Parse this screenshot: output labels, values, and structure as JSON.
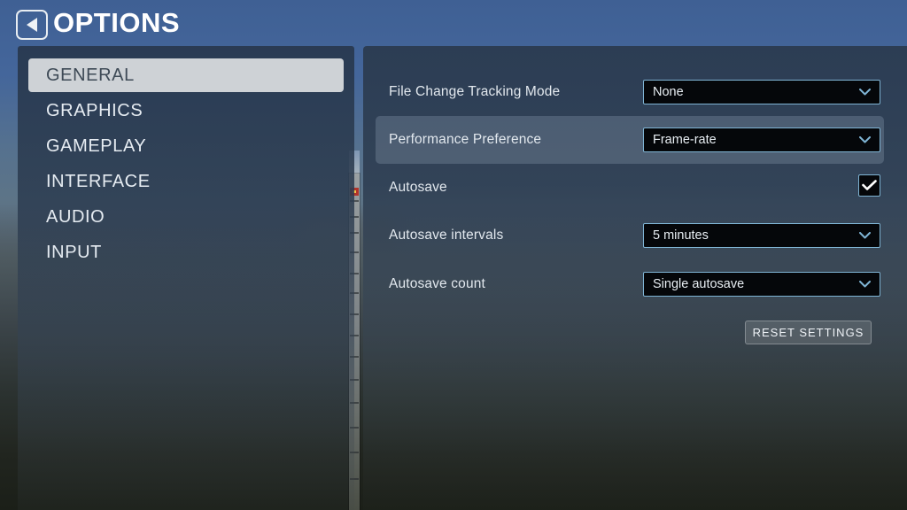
{
  "header": {
    "title": "OPTIONS",
    "back_icon": "back-arrow-icon"
  },
  "sidebar": {
    "items": [
      {
        "label": "GENERAL",
        "selected": true
      },
      {
        "label": "GRAPHICS",
        "selected": false
      },
      {
        "label": "GAMEPLAY",
        "selected": false
      },
      {
        "label": "INTERFACE",
        "selected": false
      },
      {
        "label": "AUDIO",
        "selected": false
      },
      {
        "label": "INPUT",
        "selected": false
      }
    ]
  },
  "settings": {
    "rows": [
      {
        "label": "File Change Tracking Mode",
        "control": "dropdown",
        "value": "None",
        "highlighted": false
      },
      {
        "label": "Performance Preference",
        "control": "dropdown",
        "value": "Frame-rate",
        "highlighted": true
      },
      {
        "label": "Autosave",
        "control": "checkbox",
        "checked": true,
        "highlighted": false
      },
      {
        "label": "Autosave intervals",
        "control": "dropdown",
        "value": "5 minutes",
        "highlighted": false
      },
      {
        "label": "Autosave count",
        "control": "dropdown",
        "value": "Single autosave",
        "highlighted": false
      }
    ],
    "reset_label": "RESET SETTINGS"
  },
  "colors": {
    "accent_border": "#7fb4d4",
    "dropdown_bg": "#05070a",
    "selected_item_bg": "#ced2d6",
    "selected_item_text": "#3e4a56",
    "panel_bg": "#2b3b50",
    "hover_row_bg": "#92a3b5",
    "text": "#e2e8ee"
  }
}
